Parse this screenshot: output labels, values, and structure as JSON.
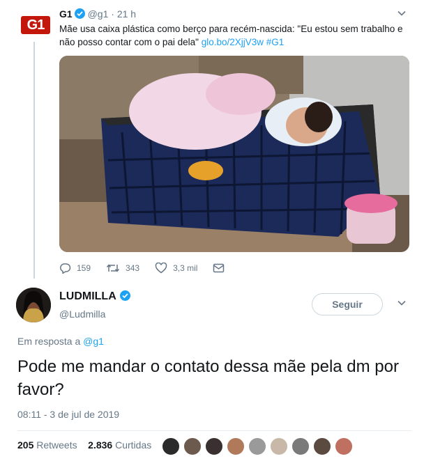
{
  "parent_tweet": {
    "logo_text": "G1",
    "name": "G1",
    "handle": "@g1",
    "dot": "·",
    "time": "21 h",
    "text": "Mãe usa caixa plástica como berço para recém-nascida: \"Eu estou sem trabalho e não posso contar com o pai dela\"",
    "link": "glo.bo/2XjjV3w",
    "hashtag": "#G1",
    "replies": "159",
    "retweets": "343",
    "likes": "3,3 mil"
  },
  "main_tweet": {
    "name": "LUDMILLA",
    "handle": "@Ludmilla",
    "follow_label": "Seguir",
    "reply_prefix": "Em resposta a",
    "reply_handle": "@g1",
    "text": "Pode me mandar o contato dessa mãe pela dm por favor?",
    "timestamp": "08:11 - 3 de jul de 2019",
    "retweet_count": "205",
    "retweet_label": "Retweets",
    "like_count": "2.836",
    "like_label": "Curtidas"
  },
  "colors": {
    "accent": "#1da1f2",
    "g1_red": "#c4170c",
    "muted": "#657786"
  },
  "icons": [
    "verified-icon",
    "chevron-down-icon",
    "reply-icon",
    "retweet-icon",
    "like-icon",
    "dm-icon"
  ]
}
